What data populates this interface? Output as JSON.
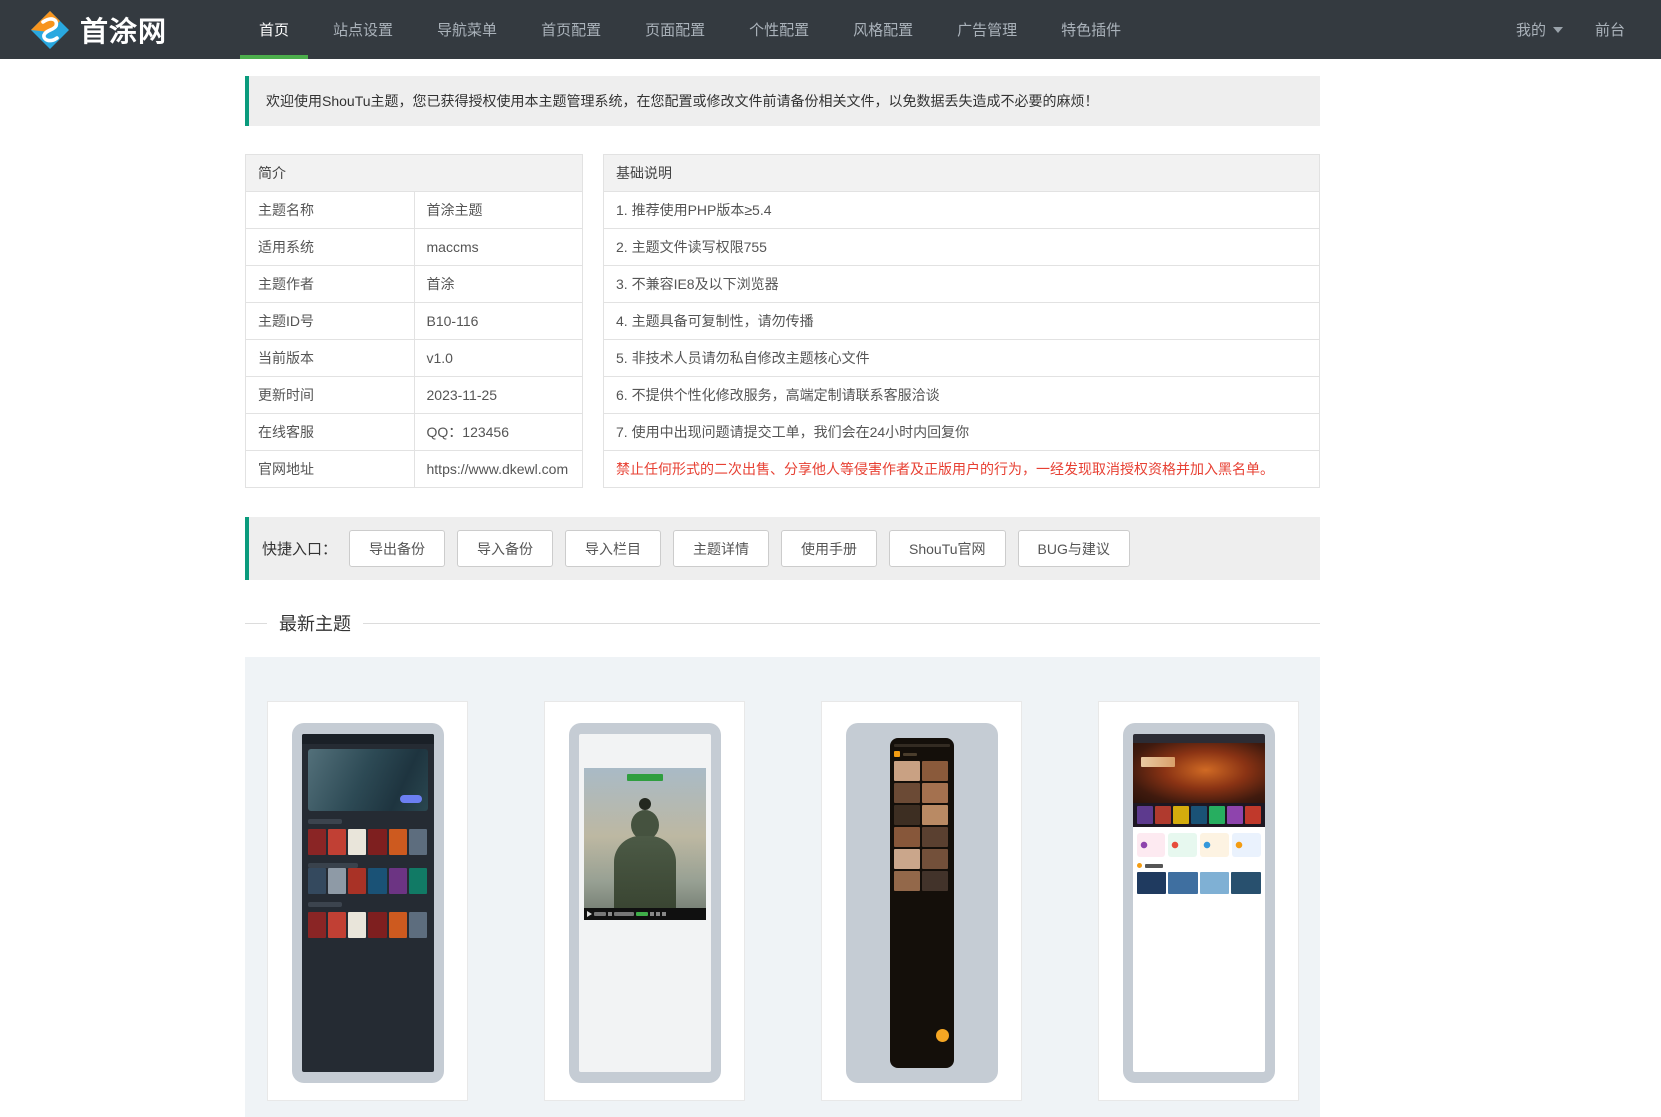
{
  "colors": {
    "navbar_bg": "#343a40",
    "nav_active_underline": "#4cae4c",
    "accent_teal": "#0a9b7d",
    "warning_red": "#e74033",
    "themes_section_bg": "#eff3f6",
    "thumbnail_gray": "#c5ccd4",
    "logo_orange": "#f7941e",
    "logo_blue": "#29a8e0"
  },
  "brand": {
    "name": "首涂网",
    "logo_icon": "shoutu-diamond-logo"
  },
  "nav": {
    "items": [
      {
        "label": "首页",
        "active": true
      },
      {
        "label": "站点设置"
      },
      {
        "label": "导航菜单"
      },
      {
        "label": "首页配置"
      },
      {
        "label": "页面配置"
      },
      {
        "label": "个性配置"
      },
      {
        "label": "风格配置"
      },
      {
        "label": "广告管理"
      },
      {
        "label": "特色插件"
      }
    ],
    "right": [
      {
        "label": "我的",
        "has_dropdown": true,
        "dropdown_icon": "caret-down-icon"
      },
      {
        "label": "前台"
      }
    ]
  },
  "alert": {
    "text": "欢迎使用ShouTu主题，您已获得授权使用本主题管理系统，在您配置或修改文件前请备份相关文件，以免数据丢失造成不必要的麻烦！"
  },
  "intro_table": {
    "title": "简介",
    "rows": [
      {
        "label": "主题名称",
        "value": "首涂主题"
      },
      {
        "label": "适用系统",
        "value": "maccms"
      },
      {
        "label": "主题作者",
        "value": "首涂"
      },
      {
        "label": "主题ID号",
        "value": "B10-116"
      },
      {
        "label": "当前版本",
        "value": "v1.0"
      },
      {
        "label": "更新时间",
        "value": "2023-11-25"
      },
      {
        "label": "在线客服",
        "value": "QQ：123456"
      },
      {
        "label": "官网地址",
        "value": "https://www.dkewl.com"
      }
    ]
  },
  "notes_table": {
    "title": "基础说明",
    "rows": [
      {
        "text": "1. 推荐使用PHP版本≥5.4"
      },
      {
        "text": "2. 主题文件读写权限755"
      },
      {
        "text": "3. 不兼容IE8及以下浏览器"
      },
      {
        "text": "4. 主题具备可复制性，请勿传播"
      },
      {
        "text": "5. 非技术人员请勿私自修改主题核心文件"
      },
      {
        "text": "6. 不提供个性化修改服务，高端定制请联系客服洽谈"
      },
      {
        "text": "7. 使用中出现问题请提交工单，我们会在24小时内回复你"
      },
      {
        "text": "禁止任何形式的二次出售、分享他人等侵害作者及正版用户的行为，一经发现取消授权资格并加入黑名单。",
        "warning": true
      }
    ]
  },
  "quick_entry": {
    "label": "快捷入口：",
    "buttons": [
      {
        "label": "导出备份"
      },
      {
        "label": "导入备份"
      },
      {
        "label": "导入栏目"
      },
      {
        "label": "主题详情"
      },
      {
        "label": "使用手册"
      },
      {
        "label": "ShouTu官网"
      },
      {
        "label": "BUG与建议"
      }
    ]
  },
  "latest_themes": {
    "title": "最新主题",
    "cards": [
      {
        "name": "dark-tablet-movie-theme-preview"
      },
      {
        "name": "video-player-theme-preview"
      },
      {
        "name": "mobile-app-theme-preview"
      },
      {
        "name": "desktop-movie-theme-preview"
      }
    ]
  }
}
